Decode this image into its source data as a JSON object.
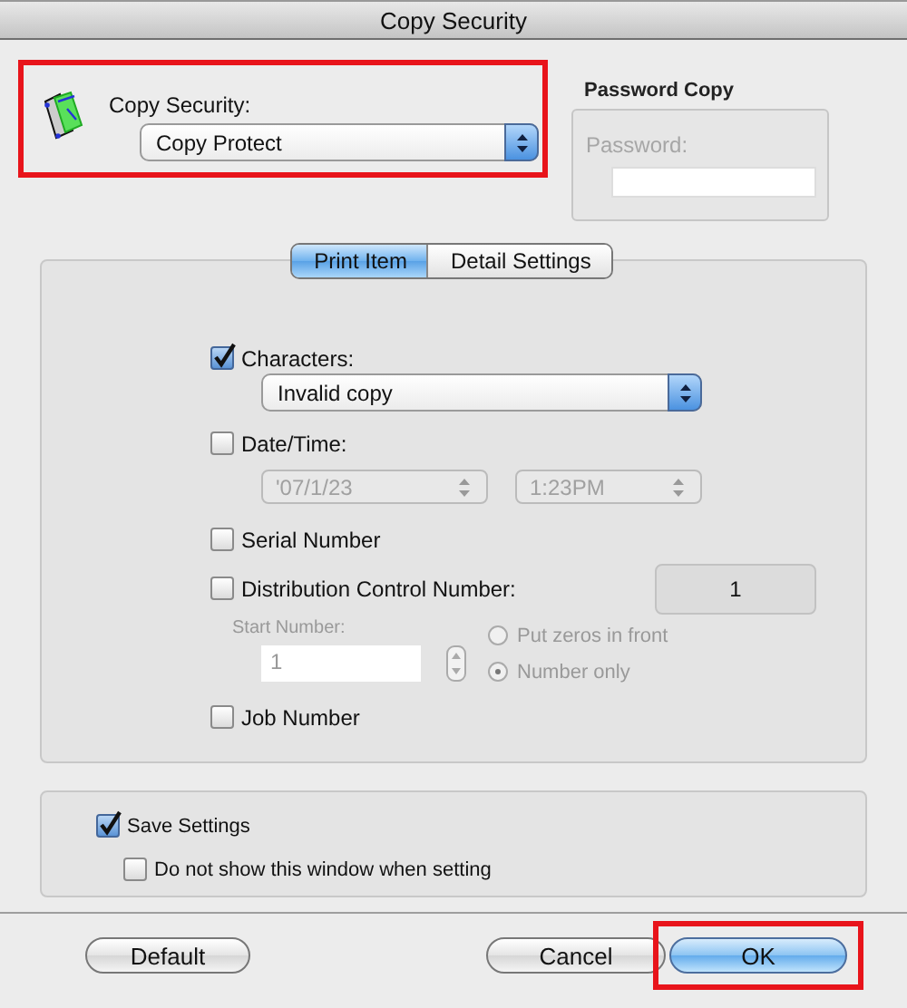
{
  "window": {
    "title": "Copy Security"
  },
  "copy_security": {
    "label": "Copy Security:",
    "value": "Copy Protect",
    "highlighted": true
  },
  "password_copy": {
    "title": "Password Copy",
    "label": "Password:",
    "disabled": true
  },
  "tabs": [
    {
      "label": "Print Item",
      "selected": true
    },
    {
      "label": "Detail Settings",
      "selected": false
    }
  ],
  "print_items": [
    {
      "kind": "popup",
      "label": "Characters:",
      "checked": true,
      "value": "Invalid copy"
    },
    {
      "kind": "datetime",
      "label": "Date/Time:",
      "checked": false,
      "date": "'07/1/23",
      "time": "1:23PM"
    },
    {
      "kind": "plain",
      "label": "Serial Number",
      "checked": false
    },
    {
      "kind": "distribution",
      "label": "Distribution Control Number:",
      "checked": false,
      "number": "1",
      "start_label": "Start Number:",
      "start_value": "1",
      "options": [
        {
          "label": "Put zeros in front",
          "selected": false
        },
        {
          "label": "Number only",
          "selected": true
        }
      ]
    },
    {
      "kind": "plain",
      "label": "Job Number",
      "checked": false
    }
  ],
  "save_settings": {
    "label": "Save Settings",
    "checked": true
  },
  "hide_window": {
    "label": "Do not show this window when setting",
    "checked": false
  },
  "buttons": [
    {
      "label": "Default",
      "kind": "push",
      "highlighted": false
    },
    {
      "label": "Cancel",
      "kind": "push",
      "highlighted": false
    },
    {
      "label": "OK",
      "kind": "default",
      "highlighted": true
    }
  ]
}
